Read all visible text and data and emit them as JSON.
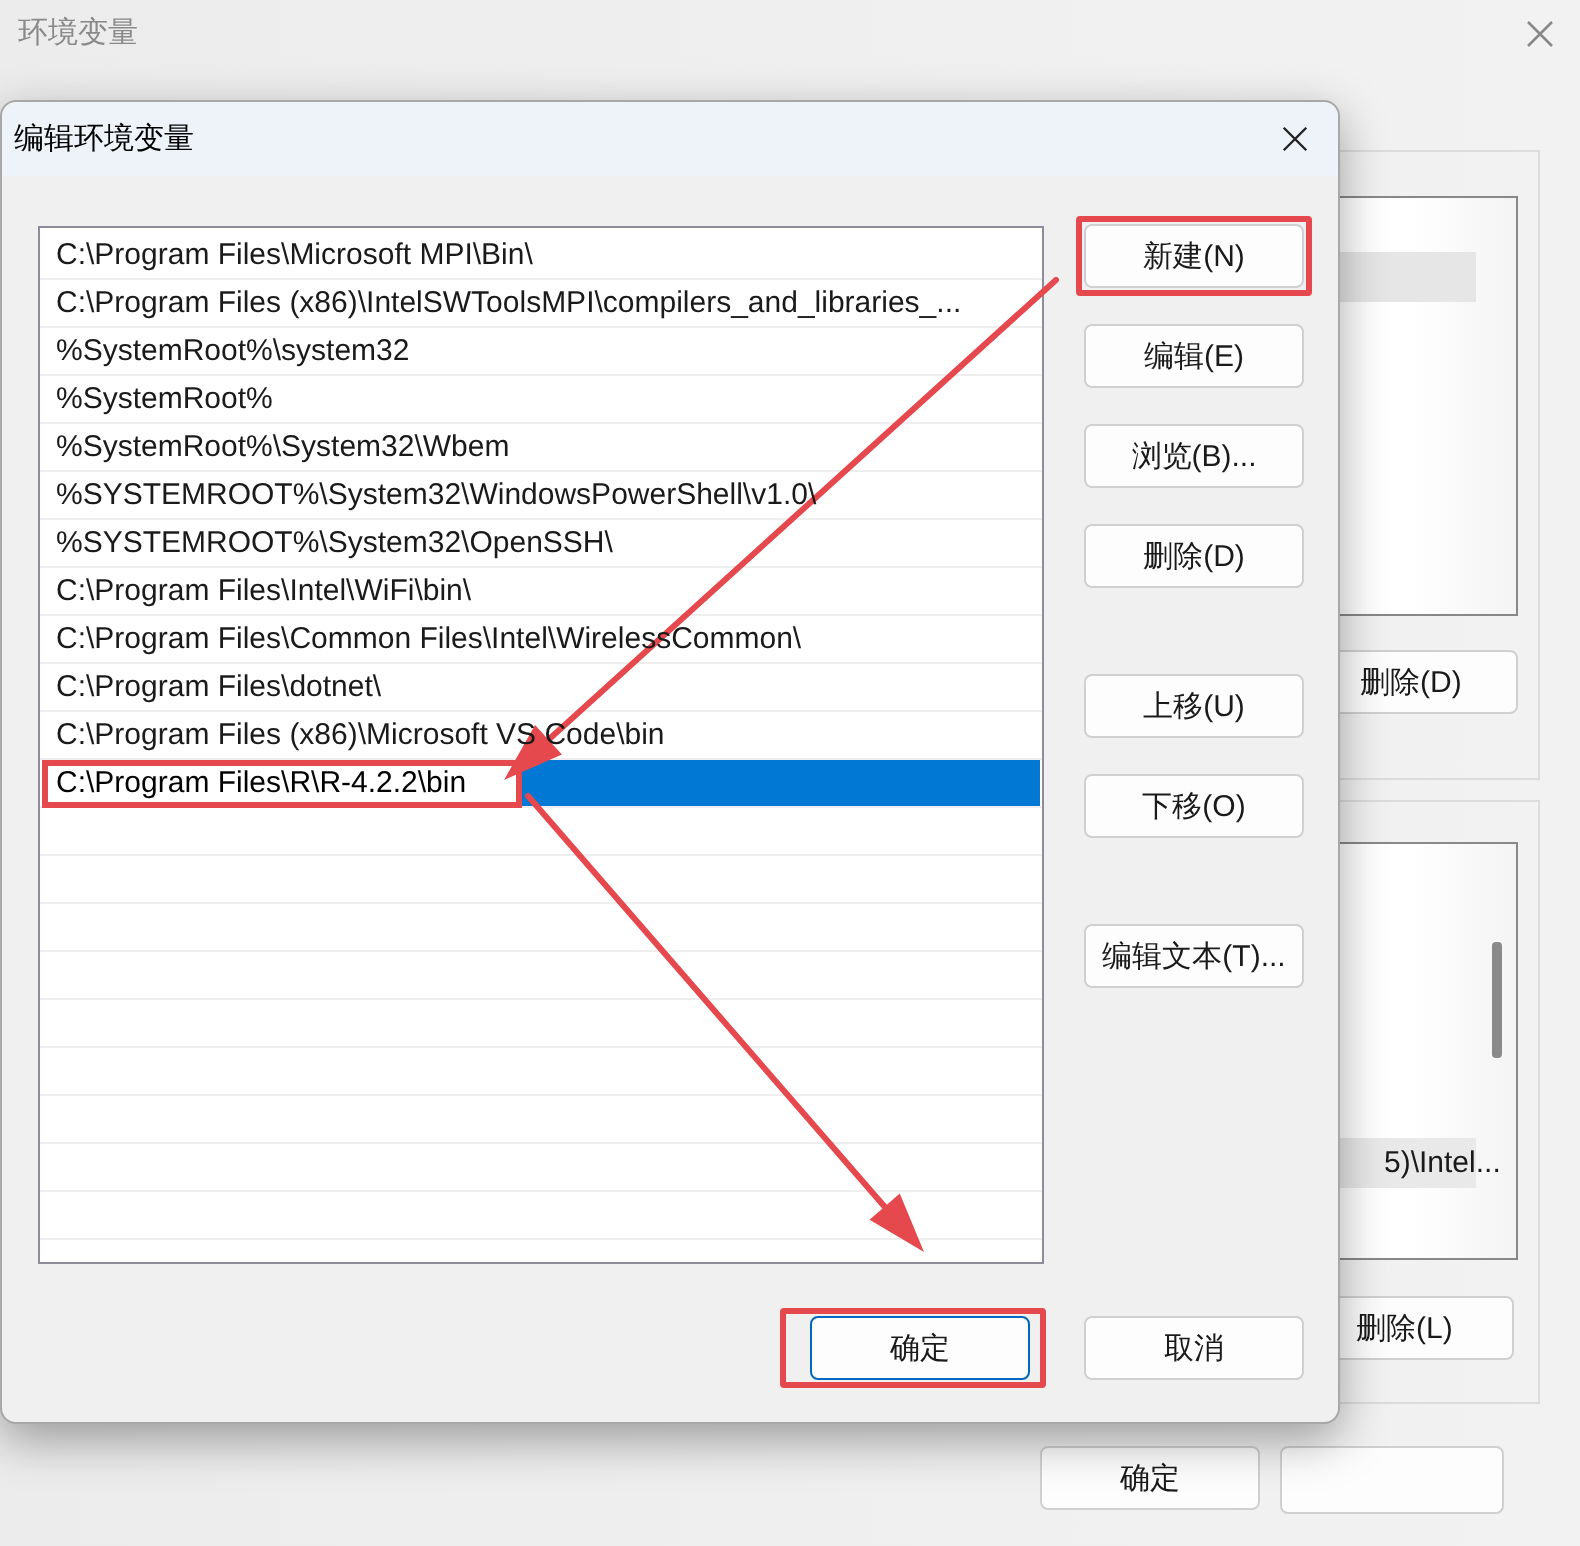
{
  "background_window": {
    "title": "环境变量",
    "upper_panel": {
      "button": "删除(D)"
    },
    "lower_panel": {
      "rows": [
        {
          "text": "5)\\Intel...",
          "selected": true
        }
      ],
      "button": "删除(L)"
    },
    "footer_buttons": [
      "确定"
    ]
  },
  "dialog": {
    "title": "编辑环境变量",
    "paths": [
      {
        "text": "C:\\Program Files\\Microsoft MPI\\Bin\\",
        "selected": false,
        "editing": false,
        "highlighted": false
      },
      {
        "text": "C:\\Program Files (x86)\\IntelSWToolsMPI\\compilers_and_libraries_...",
        "selected": false,
        "editing": false,
        "highlighted": false
      },
      {
        "text": "%SystemRoot%\\system32",
        "selected": false,
        "editing": false,
        "highlighted": false
      },
      {
        "text": "%SystemRoot%",
        "selected": false,
        "editing": false,
        "highlighted": false
      },
      {
        "text": "%SystemRoot%\\System32\\Wbem",
        "selected": false,
        "editing": false,
        "highlighted": false
      },
      {
        "text": "%SYSTEMROOT%\\System32\\WindowsPowerShell\\v1.0\\",
        "selected": false,
        "editing": false,
        "highlighted": false
      },
      {
        "text": "%SYSTEMROOT%\\System32\\OpenSSH\\",
        "selected": false,
        "editing": false,
        "highlighted": false
      },
      {
        "text": "C:\\Program Files\\Intel\\WiFi\\bin\\",
        "selected": false,
        "editing": false,
        "highlighted": false
      },
      {
        "text": "C:\\Program Files\\Common Files\\Intel\\WirelessCommon\\",
        "selected": false,
        "editing": false,
        "highlighted": false
      },
      {
        "text": "C:\\Program Files\\dotnet\\",
        "selected": false,
        "editing": false,
        "highlighted": false
      },
      {
        "text": "C:\\Program Files (x86)\\Microsoft VS Code\\bin",
        "selected": false,
        "editing": false,
        "highlighted": false
      },
      {
        "text": "C:\\Program Files\\R\\R-4.2.2\\bin",
        "selected": true,
        "editing": true,
        "highlighted": true
      }
    ],
    "side_button_groups": [
      [
        {
          "label": "新建(N)",
          "highlighted": true
        },
        {
          "label": "编辑(E)",
          "highlighted": false
        },
        {
          "label": "浏览(B)...",
          "highlighted": false
        },
        {
          "label": "删除(D)",
          "highlighted": false
        }
      ],
      [
        {
          "label": "上移(U)",
          "highlighted": false
        },
        {
          "label": "下移(O)",
          "highlighted": false
        }
      ],
      [
        {
          "label": "编辑文本(T)...",
          "highlighted": false
        }
      ]
    ],
    "footer_buttons": [
      {
        "label": "确定",
        "default": true,
        "highlighted": true
      },
      {
        "label": "取消",
        "default": false,
        "highlighted": false
      }
    ]
  }
}
